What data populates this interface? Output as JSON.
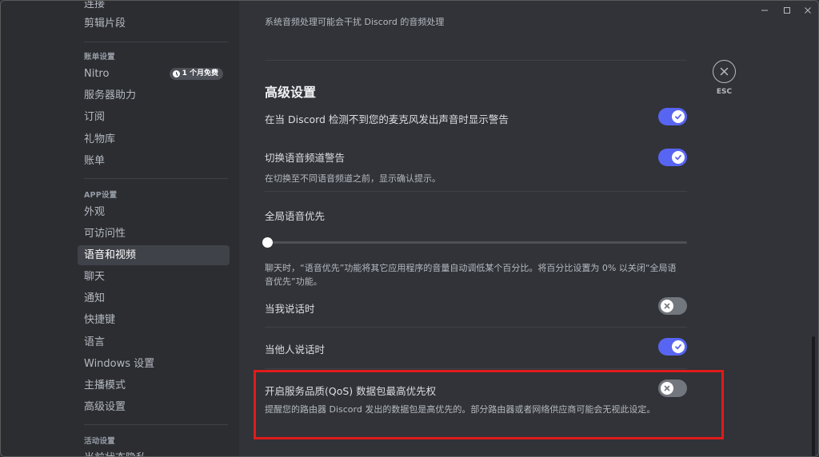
{
  "sidebar": {
    "top_items": [
      "连接",
      "剪辑片段"
    ],
    "billing_header": "账单设置",
    "billing_items": [
      "Nitro",
      "服务器助力",
      "订阅",
      "礼物库",
      "账单"
    ],
    "nitro_badge": "1 个月免费",
    "app_header": "APP设置",
    "app_items": [
      "外观",
      "可访问性",
      "语音和视频",
      "聊天",
      "通知",
      "快捷键",
      "语言",
      "Windows 设置",
      "主播模式",
      "高级设置"
    ],
    "activity_header": "活动设置",
    "activity_items": [
      "当前状态隐私"
    ]
  },
  "content": {
    "top_cut_text": "系统音频处理可能会干扰 Discord 的音频处理",
    "section_title": "高级设置",
    "settings": [
      {
        "title": "在当 Discord 检测不到您的麦克风发出声音时显示警告",
        "desc": "",
        "enabled": true
      },
      {
        "title": "切换语音频道警告",
        "desc": "在切换至不同语音频道之前，显示确认提示。",
        "enabled": true
      },
      {
        "title": "全局语音优先",
        "desc_line1": "聊天时，“语音优先”功能将其它应用程序的音量自动调低某个百分比。将百分比设置为 0% 以关闭“全局语",
        "desc_line2": "音优先”功能。",
        "slider_value": 0
      },
      {
        "title": "当我说话时",
        "enabled": false
      },
      {
        "title": "当他人说话时",
        "enabled": true
      },
      {
        "title": "开启服务品质(QoS) 数据包最高优先权",
        "desc": "提醒您的路由器 Discord 发出的数据包是高优先的。部分路由器或者网络供应商可能会无视此设定。",
        "enabled": false
      }
    ],
    "esc_label": "ESC"
  },
  "colors": {
    "accent": "#5865f2",
    "highlight": "#e01b1b"
  }
}
